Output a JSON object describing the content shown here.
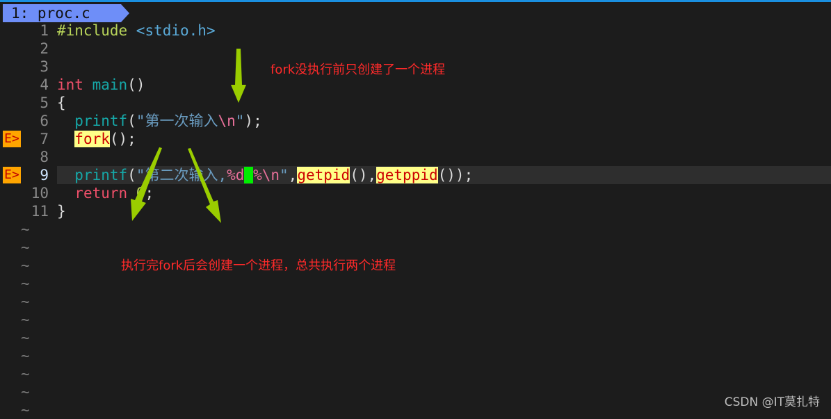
{
  "tab": {
    "label": "1: proc.c"
  },
  "colors": {
    "arrow": "#9acd00",
    "annotation": "#ff2a2a",
    "sign_bg": "#ffa500",
    "highlight_bg": "#ffff88"
  },
  "lines": [
    {
      "n": "1",
      "sign": "",
      "tokens": [
        {
          "t": "#include ",
          "c": "pp"
        },
        {
          "t": "<stdio.h>",
          "c": "inc"
        }
      ]
    },
    {
      "n": "2",
      "sign": "",
      "tokens": []
    },
    {
      "n": "3",
      "sign": "",
      "tokens": []
    },
    {
      "n": "4",
      "sign": "",
      "tokens": [
        {
          "t": "int",
          "c": "k"
        },
        {
          "t": " ",
          "c": "p"
        },
        {
          "t": "main",
          "c": "fn"
        },
        {
          "t": "()",
          "c": "p"
        }
      ]
    },
    {
      "n": "5",
      "sign": "",
      "tokens": [
        {
          "t": "{",
          "c": "p"
        }
      ]
    },
    {
      "n": "6",
      "sign": "",
      "tokens": [
        {
          "t": "  ",
          "c": "p"
        },
        {
          "t": "printf",
          "c": "fn"
        },
        {
          "t": "(",
          "c": "p"
        },
        {
          "t": "\"第一次输入",
          "c": "str"
        },
        {
          "t": "\\n",
          "c": "esc"
        },
        {
          "t": "\"",
          "c": "str"
        },
        {
          "t": ");",
          "c": "p"
        }
      ]
    },
    {
      "n": "7",
      "sign": "E>",
      "tokens": [
        {
          "t": "  ",
          "c": "p"
        },
        {
          "t": "fork",
          "c": "hl"
        },
        {
          "t": "();",
          "c": "p"
        }
      ]
    },
    {
      "n": "8",
      "sign": "",
      "tokens": []
    },
    {
      "n": "9",
      "sign": "E>",
      "current": true,
      "tokens": [
        {
          "t": "  ",
          "c": "p"
        },
        {
          "t": "printf",
          "c": "fn"
        },
        {
          "t": "(",
          "c": "p"
        },
        {
          "t": "\"第二次输入,",
          "c": "str"
        },
        {
          "t": "%d",
          "c": "esc"
        },
        {
          "t": " ",
          "c": "cursor"
        },
        {
          "t": "%",
          "c": "esc"
        },
        {
          "t": "\\n",
          "c": "esc"
        },
        {
          "t": "\"",
          "c": "str"
        },
        {
          "t": ",",
          "c": "p"
        },
        {
          "t": "getpid",
          "c": "hl"
        },
        {
          "t": "(),",
          "c": "p"
        },
        {
          "t": "getppid",
          "c": "hl"
        },
        {
          "t": "());",
          "c": "p"
        }
      ]
    },
    {
      "n": "10",
      "sign": "",
      "tokens": [
        {
          "t": "  ",
          "c": "p"
        },
        {
          "t": "return",
          "c": "k"
        },
        {
          "t": " 0",
          "c": "pp"
        },
        {
          "t": ";",
          "c": "p"
        }
      ]
    },
    {
      "n": "11",
      "sign": "",
      "tokens": [
        {
          "t": "}",
          "c": "p"
        }
      ]
    }
  ],
  "tilde_char": "~",
  "tilde_count": 11,
  "annotations": {
    "before_fork": "fork没执行前只创建了一个进程",
    "after_fork": "执行完fork后会创建一个进程，总共执行两个进程"
  },
  "watermark": "CSDN @IT莫扎特"
}
